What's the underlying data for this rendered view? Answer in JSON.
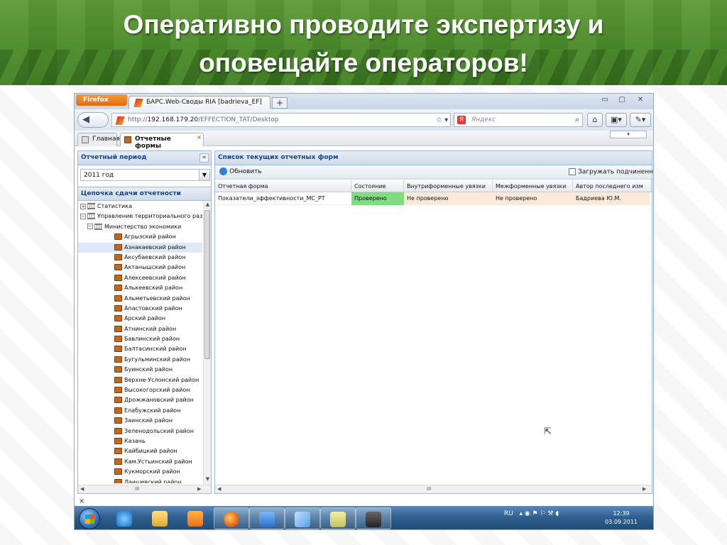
{
  "slide": {
    "title_line1": "Оперативно проводите экспертизу и",
    "title_line2": "оповещайте операторов!"
  },
  "browser": {
    "app_button": "Firefox",
    "tab_title": "БАРС.Web-Своды RIA [badrieva_EF]",
    "new_tab": "+",
    "url_prefix": "http://",
    "url_host": "192.168.179.20",
    "url_path": "/EFFECTION_TAT/Desktop",
    "search_placeholder": "Яндекс",
    "back_glyph": "◀",
    "minimize": "▭",
    "maximize": "▢",
    "close": "✕"
  },
  "app_tabs": [
    {
      "label": "Главная"
    },
    {
      "label": "Отчетные формы",
      "close": "×"
    }
  ],
  "left_panel": {
    "period_title": "Отчетный период",
    "period_value": "2011 год",
    "chain_title": "Цепочка сдачи отчетности",
    "tree": [
      {
        "label": "Статистика",
        "level": 0,
        "type": "bank",
        "exp": "+"
      },
      {
        "label": "Управление территориального разв",
        "level": 0,
        "type": "bank",
        "exp": "−"
      },
      {
        "label": "Министерство экономики",
        "level": 1,
        "type": "bank",
        "exp": "−"
      },
      {
        "label": "Агрызский район",
        "level": 2,
        "type": "org"
      },
      {
        "label": "Азнакаевский район",
        "level": 2,
        "type": "org",
        "selected": true
      },
      {
        "label": "Аксубаевский район",
        "level": 2,
        "type": "org"
      },
      {
        "label": "Актанышский район",
        "level": 2,
        "type": "org"
      },
      {
        "label": "Алексеевский район",
        "level": 2,
        "type": "org"
      },
      {
        "label": "Алькеевский район",
        "level": 2,
        "type": "org"
      },
      {
        "label": "Альметьевский район",
        "level": 2,
        "type": "org"
      },
      {
        "label": "Апастовский район",
        "level": 2,
        "type": "org"
      },
      {
        "label": "Арский район",
        "level": 2,
        "type": "org"
      },
      {
        "label": "Атнинский район",
        "level": 2,
        "type": "org"
      },
      {
        "label": "Бавлинский район",
        "level": 2,
        "type": "org"
      },
      {
        "label": "Балтасинский район",
        "level": 2,
        "type": "org"
      },
      {
        "label": "Бугульминский район",
        "level": 2,
        "type": "org"
      },
      {
        "label": "Буинский район",
        "level": 2,
        "type": "org"
      },
      {
        "label": "Верхне-Услонский район",
        "level": 2,
        "type": "org"
      },
      {
        "label": "Высокогорский район",
        "level": 2,
        "type": "org"
      },
      {
        "label": "Дрожжановский район",
        "level": 2,
        "type": "org"
      },
      {
        "label": "Елабужский район",
        "level": 2,
        "type": "org"
      },
      {
        "label": "Заинский район",
        "level": 2,
        "type": "org"
      },
      {
        "label": "Зеленодольский район",
        "level": 2,
        "type": "org"
      },
      {
        "label": "Казань",
        "level": 2,
        "type": "org"
      },
      {
        "label": "Кайбицкий район",
        "level": 2,
        "type": "org"
      },
      {
        "label": "Кам.Устьинский район",
        "level": 2,
        "type": "org"
      },
      {
        "label": "Кукморский район",
        "level": 2,
        "type": "org"
      },
      {
        "label": "Лаишевский район",
        "level": 2,
        "type": "org"
      }
    ]
  },
  "right_panel": {
    "title": "Список текущих отчетных форм",
    "refresh_label": "Обновить",
    "load_sub_label": "Загружать подчиненные",
    "columns": [
      "Отчетная форма",
      "Состояние",
      "Внутриформенные увязки",
      "Межформенные увязки",
      "Автор последнего изм"
    ],
    "rows": [
      {
        "form": "Показатели_эффективности_МС_РТ",
        "state": "Проверено",
        "intra": "Не проверено",
        "inter": "Не проверено",
        "author": "Бадриева Ю.М."
      }
    ]
  },
  "statusbar": {
    "close": "×"
  },
  "taskbar": {
    "lang": "RU",
    "time": "12:39",
    "date": "03.09.2011"
  },
  "colors": {
    "state_ok": "#7fdc7f",
    "warn_row": "#fbead8",
    "panel_border": "#99bbe8",
    "header_text": "#15428b"
  }
}
